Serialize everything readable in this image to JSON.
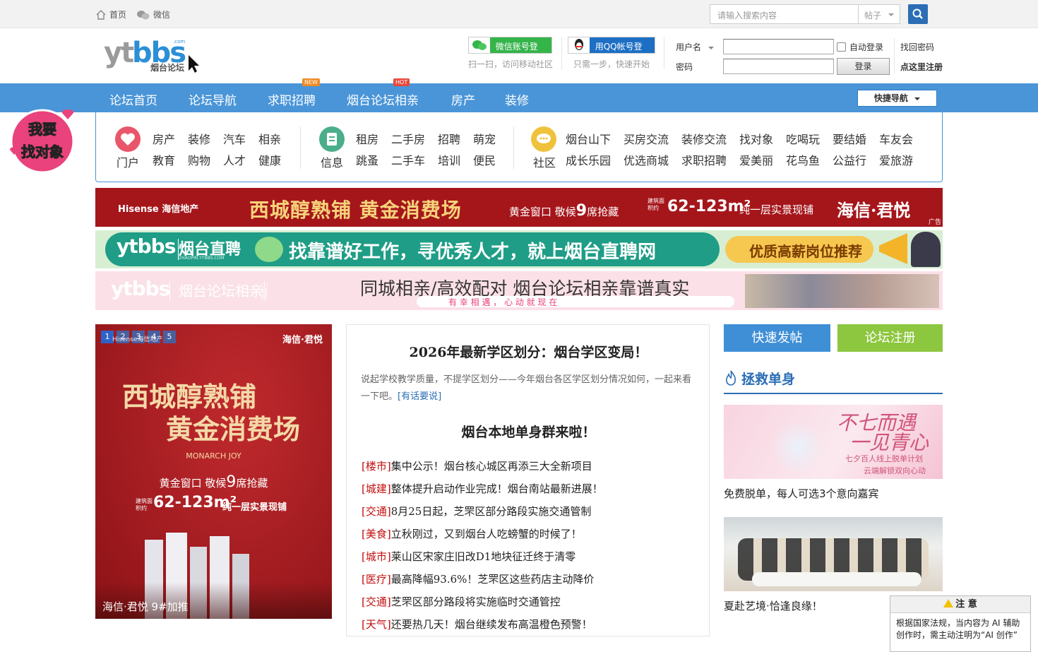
{
  "topbar": {
    "home": "首页",
    "wechat": "微信",
    "search_placeholder": "请输入搜索内容",
    "search_type": "帖子"
  },
  "logo": {
    "brand": "ytbbs",
    "sub": "烟台论坛",
    "domain": ".com"
  },
  "login": {
    "wechat_btn": "微信账号登录",
    "wechat_tip": "扫一扫，访问移动社区",
    "qq_btn": "用QQ帐号登录",
    "qq_tip": "只需一步，快速开始",
    "username_label": "用户名",
    "password_label": "密码",
    "auto_login": "自动登录",
    "login_btn": "登录",
    "forgot": "找回密码",
    "register": "点这里注册"
  },
  "nav": {
    "items": [
      "论坛首页",
      "论坛导航",
      "求职招聘",
      "烟台论坛相亲",
      "房产",
      "装修"
    ],
    "badge_new": "NEW",
    "badge_hot": "HOT",
    "quick": "快捷导航"
  },
  "subnav": {
    "portal": "门户",
    "info": "信息",
    "community": "社区",
    "portal_links": [
      "房产",
      "装修",
      "汽车",
      "相亲",
      "教育",
      "购物",
      "人才",
      "健康"
    ],
    "info_links": [
      "租房",
      "二手房",
      "招聘",
      "萌宠",
      "跳蚤",
      "二手车",
      "培训",
      "便民"
    ],
    "community_links": [
      "烟台山下",
      "买房交流",
      "装修交流",
      "找对象",
      "吃喝玩",
      "要结婚",
      "车友会",
      "成长乐园",
      "优选商城",
      "求职招聘",
      "爱美丽",
      "花鸟鱼",
      "公益行",
      "爱旅游"
    ]
  },
  "badge": {
    "line1": "我要",
    "line2": "找对象"
  },
  "banners": {
    "b1": {
      "brand": "Hisense 海信地产",
      "slogan": "西城醇熟铺 黄金消费场",
      "text1": "黄金窗口 敬候",
      "num": "9",
      "text2": "席抢藏",
      "area_pre": "建筑面积约",
      "area": "62-123m²",
      "area_post": "纯一层实景现铺",
      "project": "海信·君悦",
      "ad": "广告"
    },
    "b2": {
      "brand": "ytbbs",
      "name": "烟台直聘",
      "url": "ZHAOPIN.YTBBS.COM",
      "slogan": "找靠谱好工作，寻优秀人才，就上烟台直聘网",
      "tag": "优质高薪岗位推荐"
    },
    "b3": {
      "brand": "ytbbs",
      "name": "烟台论坛相亲",
      "small": "小程序",
      "slogan": "同城相亲/高效配对 烟台论坛相亲靠谱真实",
      "sub": "有 幸 相 遇 ， 心 动 就 现 在"
    }
  },
  "slide": {
    "pages": [
      "1",
      "2",
      "3",
      "4",
      "5"
    ],
    "overlay": "Hisense海信地产",
    "project": "海信·君悦",
    "line1": "西城醇熟铺",
    "line2": "黄金消费场",
    "en": "MONARCH JOY",
    "text1": "黄金窗口 敬候",
    "num": "9",
    "text2": "席抢藏",
    "area_pre": "建筑面积约",
    "area": "62-123m²",
    "area_post": "纯一层实景现铺",
    "caption": "海信·君悦 9#加推"
  },
  "article": {
    "headline": "2026年最新学区划分：烟台学区变局！",
    "summary": "说起学校教学质量，不提学区划分——今年烟台各区学区划分情况如何，一起来看一下吧。",
    "summary_link": "[有话要说]",
    "headline2": "烟台本地单身群来啦！",
    "news": [
      {
        "tag": "[楼市]",
        "title": "集中公示！烟台核心城区再添三大全新项目"
      },
      {
        "tag": "[城建]",
        "title": "整体提升启动作业完成！烟台南站最新进展！"
      },
      {
        "tag": "[交通]",
        "title": "8月25日起，芝罘区部分路段实施交通管制"
      },
      {
        "tag": "[美食]",
        "title": "立秋刚过，又到烟台人吃螃蟹的时候了！"
      },
      {
        "tag": "[城市]",
        "title": "莱山区宋家庄旧改D1地块征迁终于清零"
      },
      {
        "tag": "[医疗]",
        "title": "最高降幅93.6%！芝罘区这些药店主动降价"
      },
      {
        "tag": "[交通]",
        "title": "芝罘区部分路段将实施临时交通管控"
      },
      {
        "tag": "[天气]",
        "title": "还要热几天！烟台继续发布高温橙色预警！"
      }
    ]
  },
  "right": {
    "post_btn": "快速发帖",
    "register_btn": "论坛注册",
    "section_title": "拯救单身",
    "card1": {
      "title1": "不七而遇",
      "title2": "一见青心",
      "sub1": "七夕百人线上脱单计划",
      "sub2": "云端解锁双向心动",
      "caption": "免费脱单，每人可选3个意向嘉宾"
    },
    "card2": {
      "caption": "夏赴艺境·恰逢良缘！"
    }
  },
  "notice": {
    "title": "注 意",
    "body": "根据国家法规，当内容为 AI 辅助创作时，需主动注明为“AI 创作”"
  },
  "colors": {
    "nav_blue": "#4a95d8",
    "accent_blue": "#2b6eb5",
    "tag_red": "#c30d0d",
    "register_green": "#8dc63f"
  }
}
